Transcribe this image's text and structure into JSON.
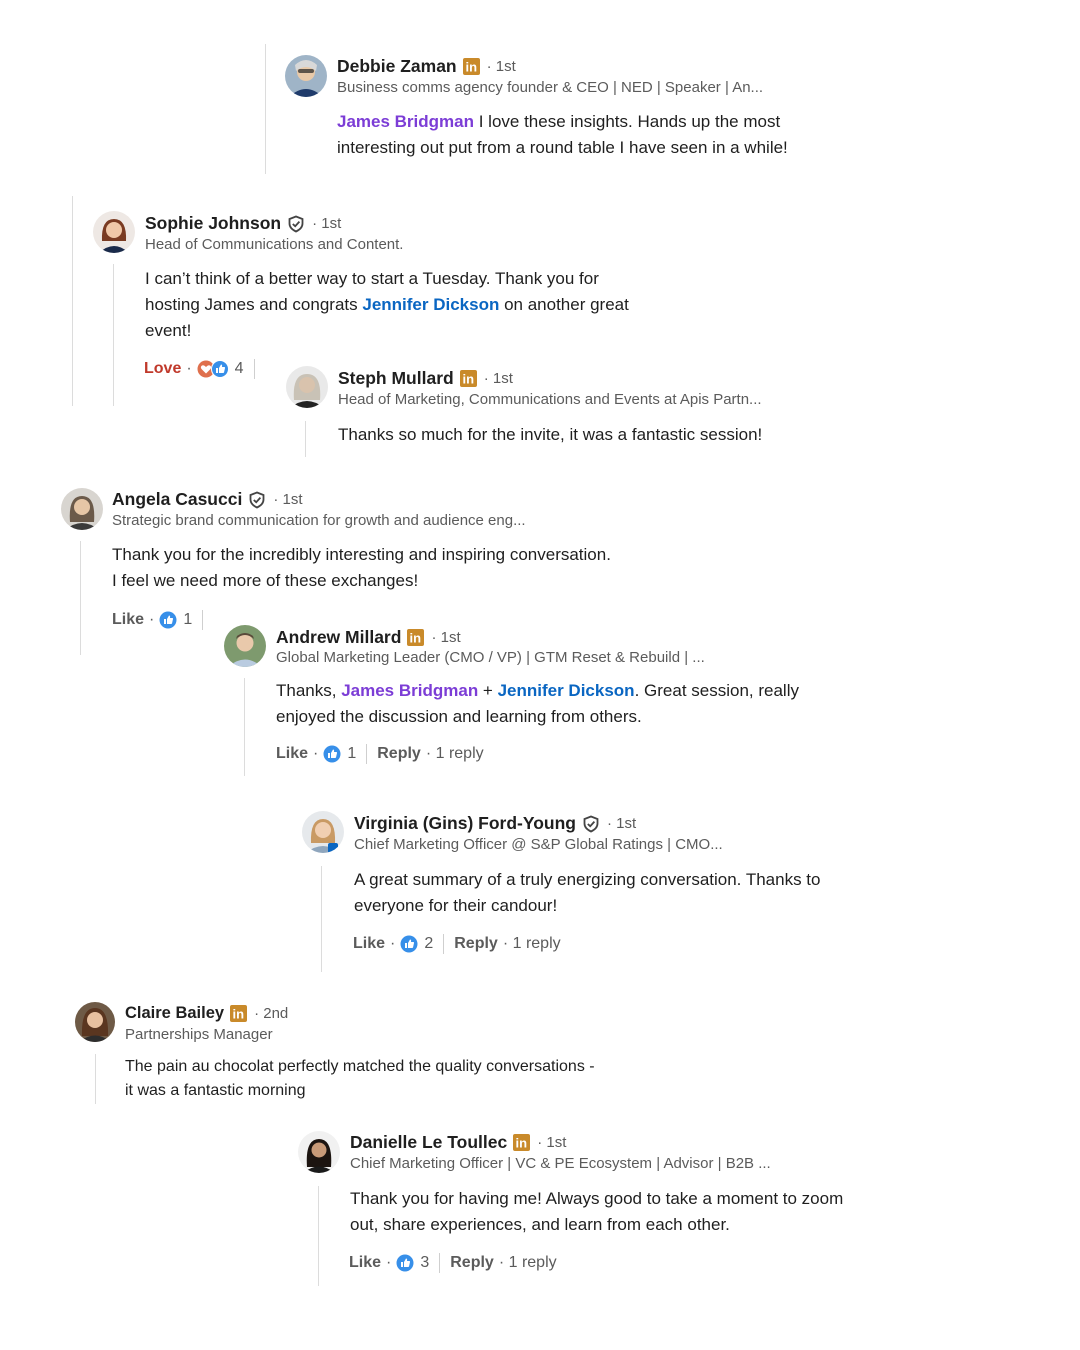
{
  "comments": {
    "debbie": {
      "name": "Debbie Zaman",
      "degree": "· 1st",
      "headline": "Business comms agency founder & CEO | NED | Speaker | An...",
      "mention": "James Bridgman",
      "text_1": " I love these insights. Hands up the most",
      "text_2": "interesting out put from a round table I have seen in a while!"
    },
    "sophie": {
      "name": "Sophie Johnson",
      "degree": "· 1st",
      "headline": "Head of Communications and Content.",
      "line_1": "I can’t think of a better way to start a Tuesday. Thank you for",
      "line_2a": "hosting James and congrats ",
      "mention": "Jennifer Dickson",
      "line_2b": " on another great",
      "line_3": "event!",
      "reaction_label": "Love",
      "reaction_count": "4"
    },
    "steph": {
      "name": "Steph Mullard",
      "degree": "· 1st",
      "headline": "Head of Marketing, Communications and Events at Apis Partn...",
      "text": "Thanks so much for the invite, it was a fantastic session!"
    },
    "angela": {
      "name": "Angela Casucci",
      "degree": "· 1st",
      "headline": "Strategic brand communication for growth and audience eng...",
      "line_1": "Thank you for the incredibly interesting and inspiring conversation.",
      "line_2": "I feel we need more of these exchanges!",
      "like_label": "Like",
      "like_count": "1"
    },
    "andrew": {
      "name": "Andrew Millard",
      "degree": "· 1st",
      "headline": "Global Marketing Leader (CMO / VP) | GTM Reset & Rebuild | ...",
      "prefix": "Thanks, ",
      "mention_1": "James Bridgman",
      "plus": " + ",
      "mention_2": "Jennifer Dickson",
      "line_1_rest": ". Great session, really",
      "line_2": "enjoyed the discussion and learning from others.",
      "like_label": "Like",
      "like_count": "1",
      "reply_label": "Reply",
      "reply_count": "· 1 reply"
    },
    "virginia": {
      "name": "Virginia (Gins) Ford-Young",
      "degree": "· 1st",
      "headline": "Chief Marketing Officer @ S&P Global Ratings | CMO...",
      "line_1": "A great summary of a truly energizing conversation. Thanks to",
      "line_2": "everyone for their candour!",
      "like_label": "Like",
      "like_count": "2",
      "reply_label": "Reply",
      "reply_count": "· 1 reply"
    },
    "claire": {
      "name": "Claire Bailey",
      "degree": "· 2nd",
      "headline": "Partnerships Manager",
      "line_1": "The pain au chocolat perfectly matched the quality conversations -",
      "line_2": "it was a fantastic morning"
    },
    "danielle": {
      "name": "Danielle Le Toullec",
      "degree": "· 1st",
      "headline": "Chief Marketing Officer | VC & PE Ecosystem | Advisor | B2B ...",
      "line_1": "Thank you for having me! Always good to take a moment to zoom",
      "line_2": "out, share experiences, and learn from each other.",
      "like_label": "Like",
      "like_count": "3",
      "reply_label": "Reply",
      "reply_count": "· 1 reply"
    }
  },
  "icons": {
    "linkedin_badge": "linkedin-premium-icon",
    "verified": "verified-shield-icon",
    "like": "like-reaction-icon",
    "love": "love-reaction-icon"
  },
  "colors": {
    "mention_purple": "#7c3dd6",
    "mention_blue": "#0a66c2",
    "love_red": "#c0392b",
    "premium_gold": "#c98a2a",
    "like_blue": "#378fe9"
  }
}
